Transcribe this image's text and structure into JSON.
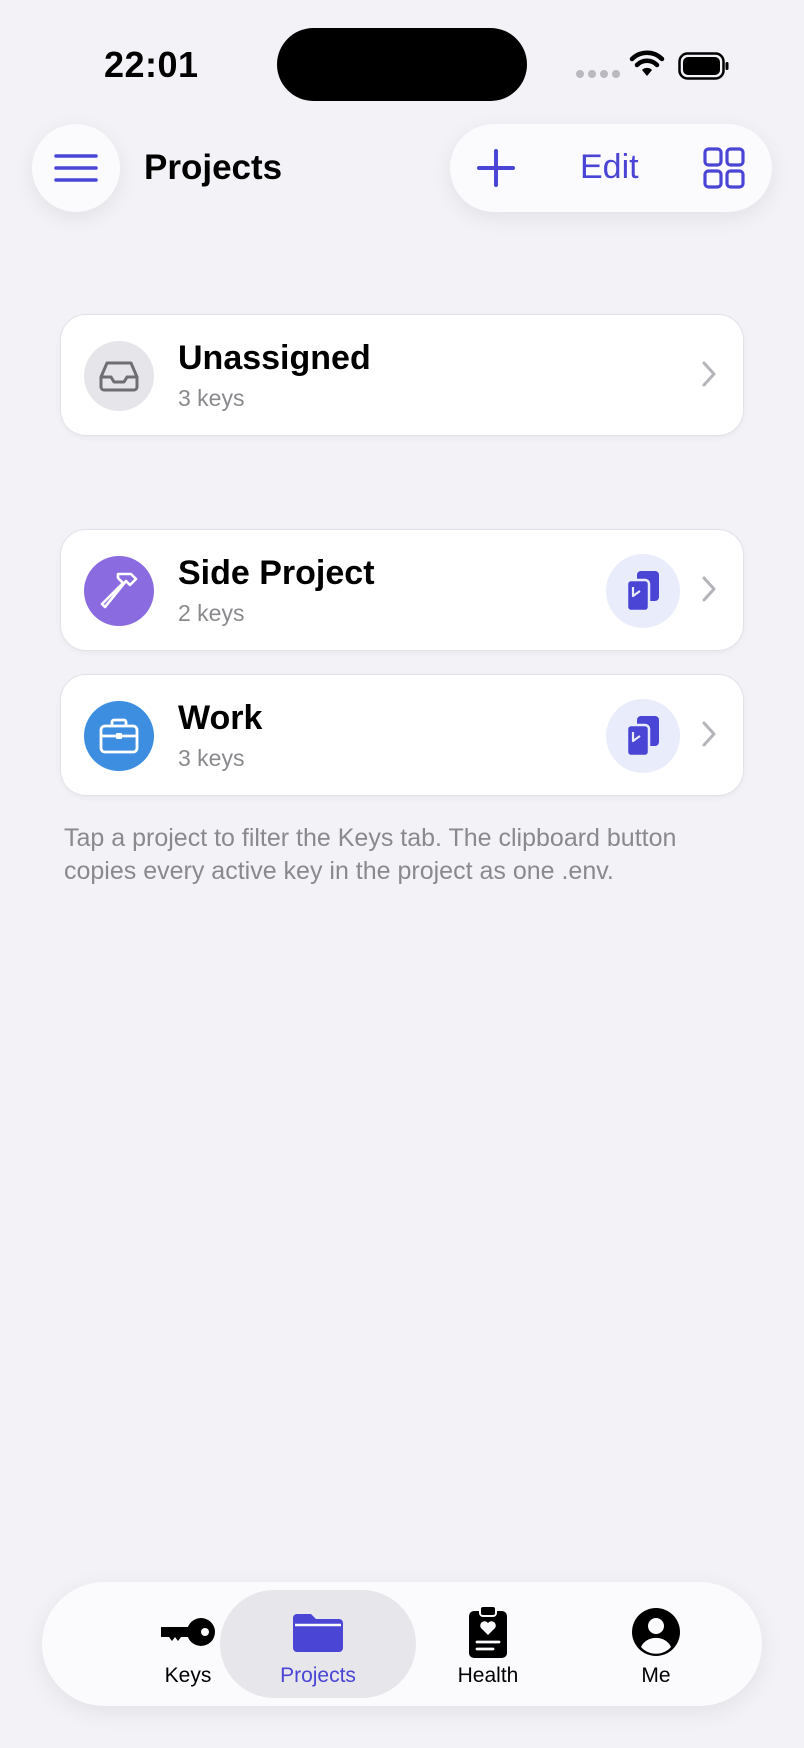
{
  "status_bar": {
    "time": "22:01"
  },
  "header": {
    "title": "Projects",
    "edit_label": "Edit",
    "menu_icon": "hamburger-menu-icon",
    "add_icon": "plus-icon",
    "grid_icon": "grid-view-icon"
  },
  "projects": [
    {
      "name": "Unassigned",
      "count": "3 keys",
      "icon": "inbox-icon",
      "icon_color": "#e6e6ea",
      "copyable": false
    },
    {
      "name": "Side Project",
      "count": "2 keys",
      "icon": "hammer-icon",
      "icon_color": "#8b6ce0",
      "copyable": true
    },
    {
      "name": "Work",
      "count": "3 keys",
      "icon": "briefcase-icon",
      "icon_color": "#3d8ee0",
      "copyable": true
    }
  ],
  "footnote": "Tap a project to filter the Keys tab. The clipboard button copies every active key in the project as one .env.",
  "tabs": [
    {
      "label": "Keys",
      "icon": "key-icon",
      "active": false
    },
    {
      "label": "Projects",
      "icon": "folder-icon",
      "active": true
    },
    {
      "label": "Health",
      "icon": "clipboard-health-icon",
      "active": false
    },
    {
      "label": "Me",
      "icon": "person-circle-icon",
      "active": false
    }
  ],
  "colors": {
    "accent": "#4a45d4",
    "background": "#f2f2f7",
    "secondary_text": "#8a8a8e"
  }
}
